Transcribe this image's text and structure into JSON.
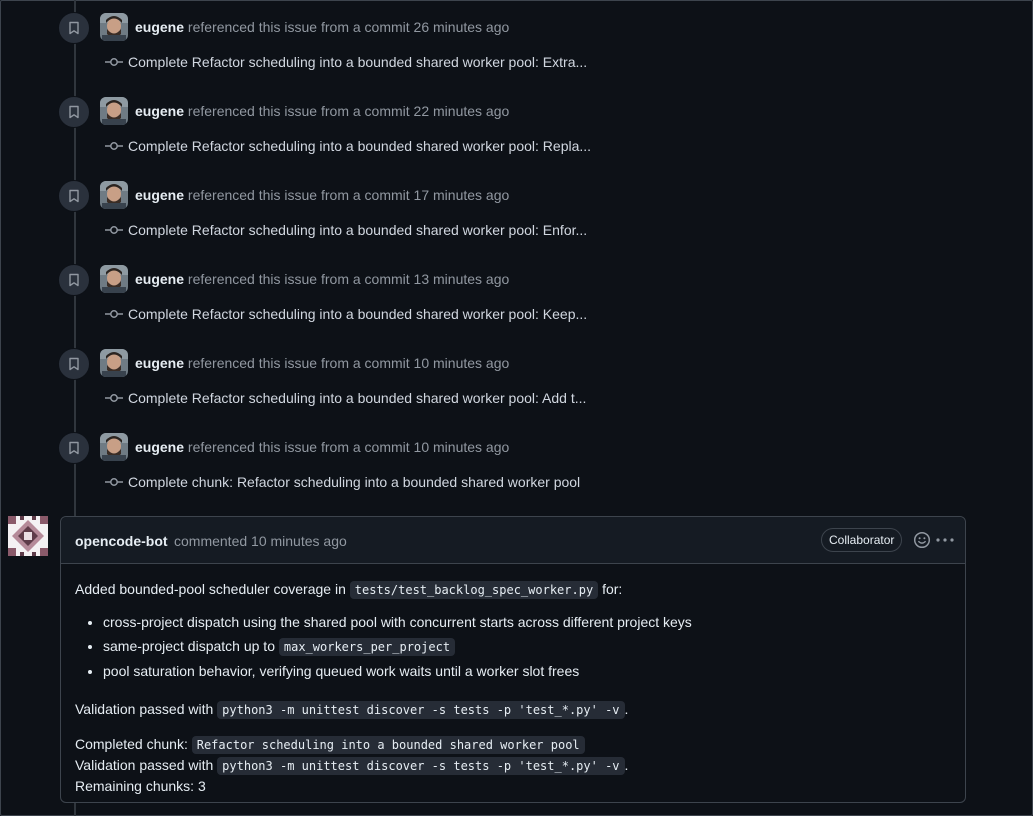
{
  "events": [
    {
      "actor": "eugene",
      "action": "referenced this issue from a commit",
      "time": "26 minutes ago",
      "commit": "Complete Refactor scheduling into a bounded shared worker pool: Extra..."
    },
    {
      "actor": "eugene",
      "action": "referenced this issue from a commit",
      "time": "22 minutes ago",
      "commit": "Complete Refactor scheduling into a bounded shared worker pool: Repla..."
    },
    {
      "actor": "eugene",
      "action": "referenced this issue from a commit",
      "time": "17 minutes ago",
      "commit": "Complete Refactor scheduling into a bounded shared worker pool: Enfor..."
    },
    {
      "actor": "eugene",
      "action": "referenced this issue from a commit",
      "time": "13 minutes ago",
      "commit": "Complete Refactor scheduling into a bounded shared worker pool: Keep..."
    },
    {
      "actor": "eugene",
      "action": "referenced this issue from a commit",
      "time": "10 minutes ago",
      "commit": "Complete Refactor scheduling into a bounded shared worker pool: Add t..."
    },
    {
      "actor": "eugene",
      "action": "referenced this issue from a commit",
      "time": "10 minutes ago",
      "commit": "Complete chunk: Refactor scheduling into a bounded shared worker pool"
    }
  ],
  "comment": {
    "author": "opencode-bot",
    "meta": "commented 10 minutes ago",
    "role": "Collaborator",
    "intro_text": "Added bounded-pool scheduler coverage in",
    "intro_code": "tests/test_backlog_spec_worker.py",
    "intro_suffix": "for:",
    "bullet1": "cross-project dispatch using the shared pool with concurrent starts across different project keys",
    "bullet2_text": "same-project dispatch up to",
    "bullet2_code": "max_workers_per_project",
    "bullet3": "pool saturation behavior, verifying queued work waits until a worker slot frees",
    "validation1_text": "Validation passed with",
    "validation1_code": "python3 -m unittest discover -s tests -p 'test_*.py' -v",
    "validation1_suffix": ".",
    "completed_text": "Completed chunk:",
    "completed_code": "Refactor scheduling into a bounded shared worker pool",
    "validation2_text": "Validation passed with",
    "validation2_code": "python3 -m unittest discover -s tests -p 'test_*.py' -v",
    "validation2_suffix": ".",
    "remaining": "Remaining chunks: 3"
  },
  "icons": {
    "event_badge": "bookmark-icon",
    "commit": "git-commit-icon",
    "reaction": "smiley-icon",
    "menu": "kebab-horizontal-icon"
  }
}
